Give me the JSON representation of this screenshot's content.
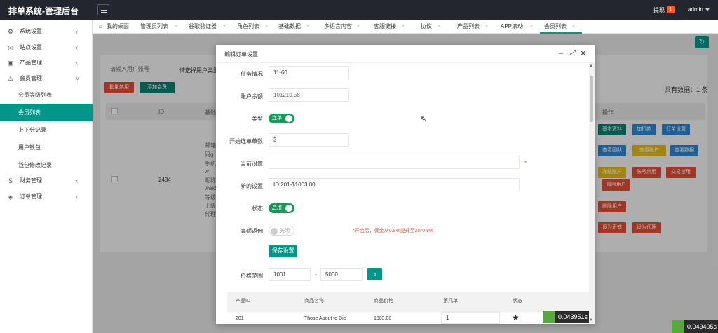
{
  "app": {
    "title": "排单系统-管理后台",
    "withdraw_label": "提现",
    "withdraw_count": "1",
    "user": "admin"
  },
  "sidebar": {
    "items": [
      {
        "label": "系统设置",
        "icon": "gear-icon"
      },
      {
        "label": "站点设置",
        "icon": "globe-icon"
      },
      {
        "label": "产品管理",
        "icon": "box-icon"
      },
      {
        "label": "会员管理",
        "icon": "user-icon"
      },
      {
        "label": "财务管理",
        "icon": "dollar-icon"
      },
      {
        "label": "订单管理",
        "icon": "order-icon"
      }
    ],
    "sub_items": [
      {
        "label": "会员等级列表"
      },
      {
        "label": "会员列表"
      },
      {
        "label": "上下分记录"
      },
      {
        "label": "用户钱包"
      },
      {
        "label": "钱包修改记录"
      }
    ]
  },
  "tabs": [
    {
      "label": "我的桌面"
    },
    {
      "label": "管理员列表"
    },
    {
      "label": "谷歌验证器"
    },
    {
      "label": "角色列表"
    },
    {
      "label": "基础数据"
    },
    {
      "label": "多语言内容"
    },
    {
      "label": "客服链接"
    },
    {
      "label": "协议"
    },
    {
      "label": "产品列表"
    },
    {
      "label": "APP滚动"
    },
    {
      "label": "会员列表"
    }
  ],
  "background": {
    "search_placeholder": "请输入用户账号",
    "select_label": "请选择用户类型",
    "batch_disable": "批量禁用",
    "add_member": "添加会员",
    "total": "共有数据：1 条",
    "col_id": "ID",
    "col_basic": "基础",
    "col_ops": "操作",
    "row_id": "2434",
    "row_info": [
      "邮箱",
      "码g",
      "手机",
      "w",
      "昵称",
      "wakd",
      "等级",
      "上级",
      "代理"
    ],
    "buttons": {
      "basic_info": "基本资料",
      "add_deduct": "加扣款",
      "order_settings": "订单设置",
      "view_team": "查看团队",
      "view_bank": "查看账户",
      "view_data": "查看数据",
      "freeze": "冻结账户",
      "account_ban": "账号禁用",
      "trade_ban": "交易禁用",
      "freeze_tag": "冒限用户",
      "delete_user": "删除用户",
      "set_official": "设为正式",
      "set_agent": "设为代理"
    }
  },
  "modal": {
    "title": "编辑订单设置",
    "task_label": "任务情况",
    "task_value": "11-60",
    "balance_label": "账户余额",
    "balance_value": "101210.58",
    "type_label": "类型",
    "type_toggle": "连单",
    "start_label": "开始连单单数",
    "start_value": "3",
    "current_label": "当前设置",
    "current_value": "",
    "required_mark": "*",
    "new_label": "新的设置",
    "new_value": "ID:201-$1003.00",
    "status_label": "状态",
    "status_toggle": "启用",
    "rebate_label": "高额返佣",
    "rebate_toggle": "关闭",
    "rebate_hint": "*开启后，佣金从0.8%提升至20*0.8%",
    "save_label": "保存设置",
    "price_label": "价格范围",
    "price_min": "1001",
    "price_sep": "-",
    "price_max": "5000",
    "table_headers": [
      "产品ID",
      "商品名称",
      "商品价格",
      "第几单",
      "状态"
    ],
    "row": {
      "id": "201",
      "name": "Those About to Die",
      "price": "1003.00",
      "order_no": "1"
    }
  },
  "timers": {
    "inner": "0.043951s",
    "outer": "0.049405s"
  }
}
